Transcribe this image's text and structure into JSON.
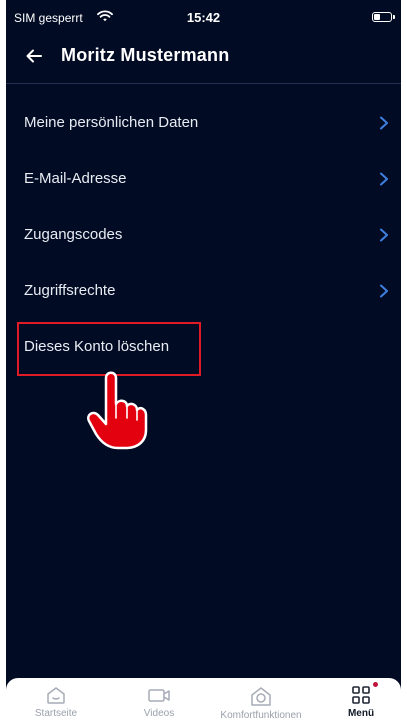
{
  "status_bar": {
    "carrier": "SIM gesperrt",
    "time": "15:42"
  },
  "header": {
    "title": "Moritz Mustermann",
    "back_icon": "arrow-left-icon"
  },
  "menu": [
    {
      "label": "Meine persönlichen Daten",
      "has_chevron": true
    },
    {
      "label": "E-Mail-Adresse",
      "has_chevron": true
    },
    {
      "label": "Zugangscodes",
      "has_chevron": true
    },
    {
      "label": "Zugriffsrechte",
      "has_chevron": true
    },
    {
      "label": "Dieses Konto löschen",
      "has_chevron": false
    }
  ],
  "tabs": [
    {
      "label": "Startseite",
      "icon": "home-icon",
      "active": false
    },
    {
      "label": "Videos",
      "icon": "video-camera-icon",
      "active": false
    },
    {
      "label": "Komfortfunktionen",
      "icon": "comfort-functions-icon",
      "active": false
    },
    {
      "label": "Menü",
      "icon": "menu-grid-icon",
      "active": true
    }
  ],
  "colors": {
    "background": "#020b24",
    "chevron": "#3f7fe0",
    "highlight": "#e11a25",
    "tabbar": "#ffffff",
    "notification_dot": "#c0123a"
  }
}
